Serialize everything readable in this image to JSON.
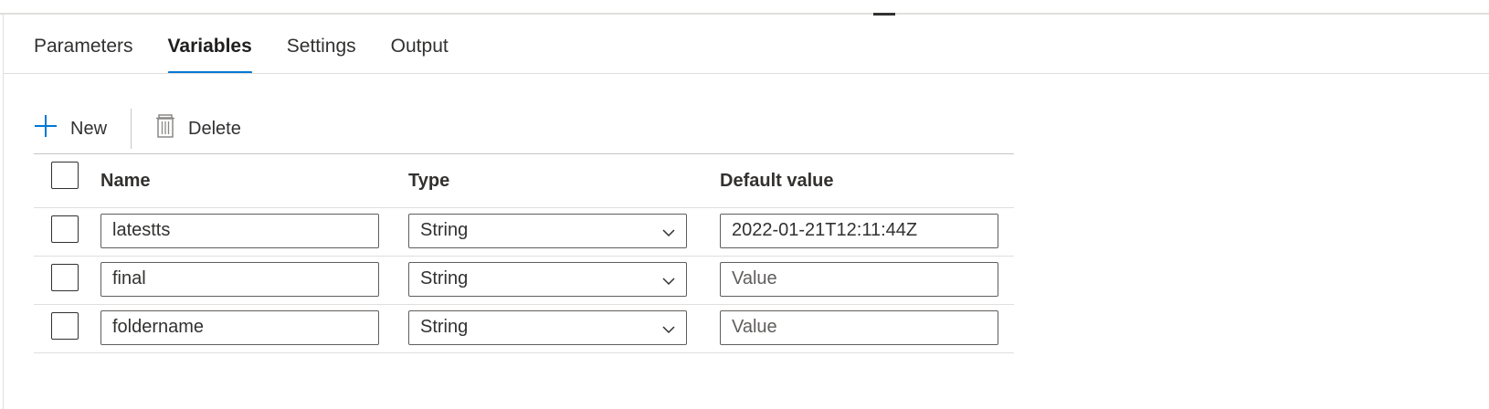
{
  "tabs": [
    {
      "label": "Parameters",
      "active": false
    },
    {
      "label": "Variables",
      "active": true
    },
    {
      "label": "Settings",
      "active": false
    },
    {
      "label": "Output",
      "active": false
    }
  ],
  "toolbar": {
    "new_label": "New",
    "delete_label": "Delete",
    "new_icon": "plus-icon",
    "delete_icon": "trash-icon"
  },
  "table": {
    "columns": [
      "Name",
      "Type",
      "Default value"
    ],
    "rows": [
      {
        "name": "latestts",
        "type": "String",
        "default_value": "2022-01-21T12:11:44Z",
        "default_placeholder": "Value"
      },
      {
        "name": "final",
        "type": "String",
        "default_value": "",
        "default_placeholder": "Value"
      },
      {
        "name": "foldername",
        "type": "String",
        "default_value": "",
        "default_placeholder": "Value"
      }
    ]
  },
  "colors": {
    "accent": "#0078d4",
    "text": "#323130",
    "border": "#e1dfdd"
  }
}
